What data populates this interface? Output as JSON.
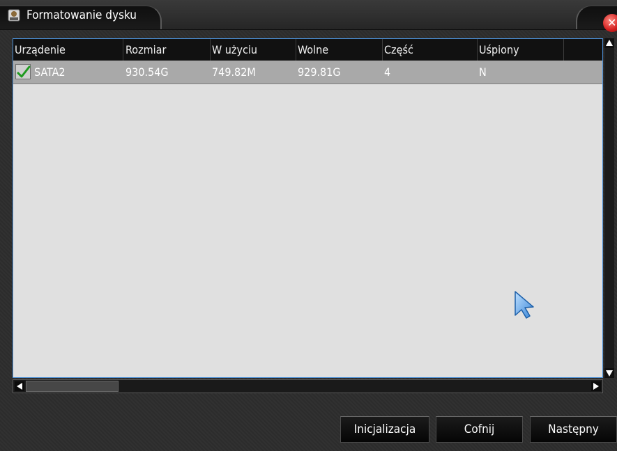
{
  "window": {
    "title": "Formatowanie dysku",
    "close_icon": "close-icon",
    "app_icon": "disk-tool-icon"
  },
  "table": {
    "columns": [
      "Urządenie",
      "Rozmiar",
      "W użyciu",
      "Wolne",
      "Część",
      "Uśpiony"
    ],
    "rows": [
      {
        "checked": true,
        "device": "SATA2",
        "size": "930.54G",
        "used": "749.82M",
        "free": "929.81G",
        "partitions": "4",
        "sleeping": "N"
      }
    ]
  },
  "buttons": {
    "init_label": "Inicjalizacja",
    "back_label": "Cofnij",
    "next_label": "Następny"
  },
  "colors": {
    "selected_row": "#a9a9a9",
    "list_background": "#e0e0e0",
    "header_background": "#111111",
    "frame_border": "#4b8fd6",
    "check_mark": "#1f9a1f",
    "close_button": "#d32020"
  }
}
